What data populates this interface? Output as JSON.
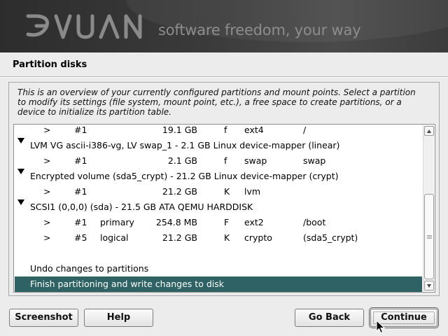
{
  "banner": {
    "logo_text": "DEVUAN",
    "tagline": "software freedom, your way"
  },
  "page": {
    "title": "Partition disks",
    "instructions": "This is an overview of your currently configured partitions and mount points. Select a partition to modify its settings (file system, mount point, etc.), a free space to create partitions, or a device to initialize its partition table."
  },
  "partitions": {
    "rows": [
      {
        "type": "partition",
        "arrow": ">",
        "num": "#1",
        "ptype": "",
        "size": "19.1 GB",
        "flag": "f",
        "fs": "ext4",
        "mount": "/"
      },
      {
        "type": "device",
        "label": "LVM VG ascii-i386-vg, LV swap_1 - 2.1 GB Linux device-mapper (linear)"
      },
      {
        "type": "partition",
        "arrow": ">",
        "num": "#1",
        "ptype": "",
        "size": "2.1 GB",
        "flag": "f",
        "fs": "swap",
        "mount": "swap"
      },
      {
        "type": "device",
        "label": "Encrypted volume (sda5_crypt) - 21.2 GB Linux device-mapper (crypt)"
      },
      {
        "type": "partition",
        "arrow": ">",
        "num": "#1",
        "ptype": "",
        "size": "21.2 GB",
        "flag": "K",
        "fs": "lvm",
        "mount": ""
      },
      {
        "type": "device",
        "label": "SCSI1 (0,0,0) (sda) - 21.5 GB ATA QEMU HARDDISK"
      },
      {
        "type": "partition",
        "arrow": ">",
        "num": "#1",
        "ptype": "primary",
        "size": "254.8 MB",
        "flag": "F",
        "fs": "ext2",
        "mount": "/boot"
      },
      {
        "type": "partition",
        "arrow": ">",
        "num": "#5",
        "ptype": "logical",
        "size": "21.2 GB",
        "flag": "K",
        "fs": "crypto",
        "mount": "(sda5_crypt)"
      },
      {
        "type": "blank"
      },
      {
        "type": "action",
        "label": "Undo changes to partitions"
      },
      {
        "type": "action",
        "label": "Finish partitioning and write changes to disk",
        "selected": true
      }
    ]
  },
  "buttons": {
    "screenshot": "Screenshot",
    "help": "Help",
    "go_back": "Go Back",
    "continue": "Continue"
  },
  "colors": {
    "selection": "#2e6264",
    "banner": "#333333"
  }
}
